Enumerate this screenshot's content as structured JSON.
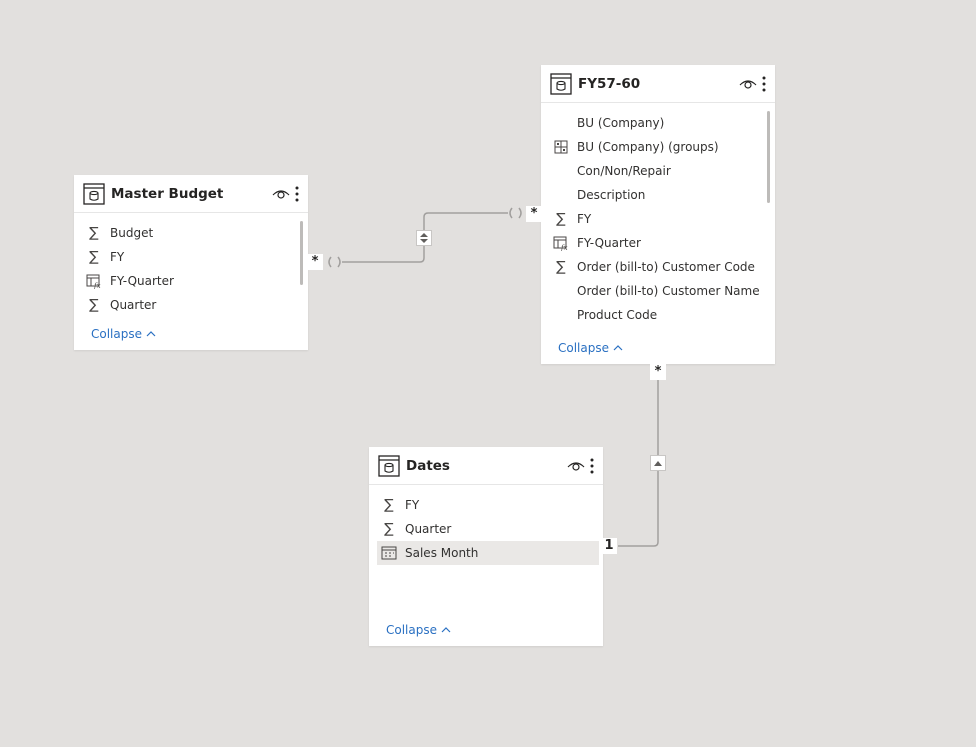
{
  "colors": {
    "canvas": "#e2e0de",
    "card": "#ffffff",
    "link": "#2a70c2",
    "line": "#a19f9d",
    "selected_row": "#eae8e6"
  },
  "tables": {
    "master_budget": {
      "title": "Master Budget",
      "icon": "table-icon",
      "fields": [
        {
          "name": "Budget",
          "icon": "sigma-icon"
        },
        {
          "name": "FY",
          "icon": "sigma-icon"
        },
        {
          "name": "FY-Quarter",
          "icon": "calculated-column-icon"
        },
        {
          "name": "Quarter",
          "icon": "sigma-icon"
        }
      ],
      "collapse_label": "Collapse"
    },
    "fy57_60": {
      "title": "FY57-60",
      "icon": "table-icon",
      "fields": [
        {
          "name": "BU (Company)",
          "icon": ""
        },
        {
          "name": "BU (Company) (groups)",
          "icon": "group-icon"
        },
        {
          "name": "Con/Non/Repair",
          "icon": ""
        },
        {
          "name": "Description",
          "icon": ""
        },
        {
          "name": "FY",
          "icon": "sigma-icon"
        },
        {
          "name": "FY-Quarter",
          "icon": "calculated-column-icon"
        },
        {
          "name": "Order (bill-to) Customer Code",
          "icon": "sigma-icon"
        },
        {
          "name": "Order (bill-to) Customer Name",
          "icon": ""
        },
        {
          "name": "Product Code",
          "icon": ""
        }
      ],
      "collapse_label": "Collapse"
    },
    "dates": {
      "title": "Dates",
      "icon": "table-icon",
      "fields": [
        {
          "name": "FY",
          "icon": "sigma-icon"
        },
        {
          "name": "Quarter",
          "icon": "sigma-icon"
        },
        {
          "name": "Sales Month",
          "icon": "calendar-icon"
        }
      ],
      "collapse_label": "Collapse"
    }
  },
  "relationships": [
    {
      "from": "Master Budget",
      "from_cardinality": "*",
      "to": "FY57-60",
      "to_cardinality": "*",
      "cross_filter": "both"
    },
    {
      "from": "Dates",
      "from_cardinality": "1",
      "to": "FY57-60",
      "to_cardinality": "*",
      "cross_filter": "single"
    }
  ]
}
